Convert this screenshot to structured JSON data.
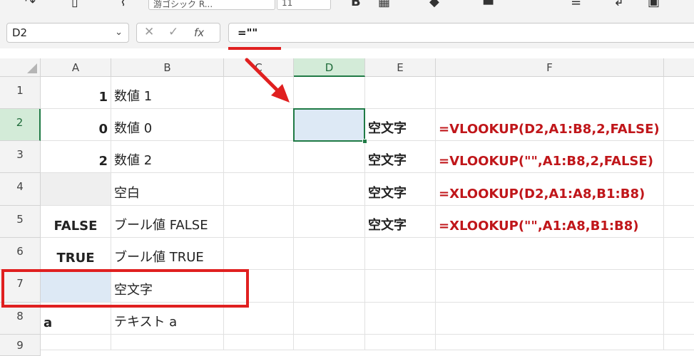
{
  "toolbar": {
    "font_name": "游ゴシック R...",
    "font_size": "11"
  },
  "formula_bar": {
    "name_box": "D2",
    "cancel_glyph": "✕",
    "confirm_glyph": "✓",
    "fx_glyph": "fx",
    "formula": "=\"\""
  },
  "columns": [
    "A",
    "B",
    "C",
    "D",
    "E",
    "F"
  ],
  "rows": [
    "1",
    "2",
    "3",
    "4",
    "5",
    "6",
    "7",
    "8",
    "9"
  ],
  "selected": {
    "column": "D",
    "row": "2"
  },
  "cells": {
    "A1": "1",
    "B1": "数値 1",
    "A2": "0",
    "B2": "数値 0",
    "A3": "2",
    "B3": "数値 2",
    "A4": "",
    "B4": "空白",
    "A5": "FALSE",
    "B5": "ブール値 FALSE",
    "A6": "TRUE",
    "B6": "ブール値 TRUE",
    "A7": "",
    "B7": "空文字",
    "A8": "a",
    "B8": "テキスト a",
    "E2": "空文字",
    "F2": "=VLOOKUP(D2,A1:B8,2,FALSE)",
    "E3": "空文字",
    "F3": "=VLOOKUP(\"\",A1:B8,2,FALSE)",
    "E4": "空文字",
    "F4": "=XLOOKUP(D2,A1:A8,B1:B8)",
    "E5": "空文字",
    "F5": "=XLOOKUP(\"\",A1:A8,B1:B8)"
  },
  "colors": {
    "accent_green": "#1f7a45",
    "annotation_red": "#e02020",
    "formula_text_red": "#c0161a",
    "highlight_blue": "#dde9f5"
  }
}
